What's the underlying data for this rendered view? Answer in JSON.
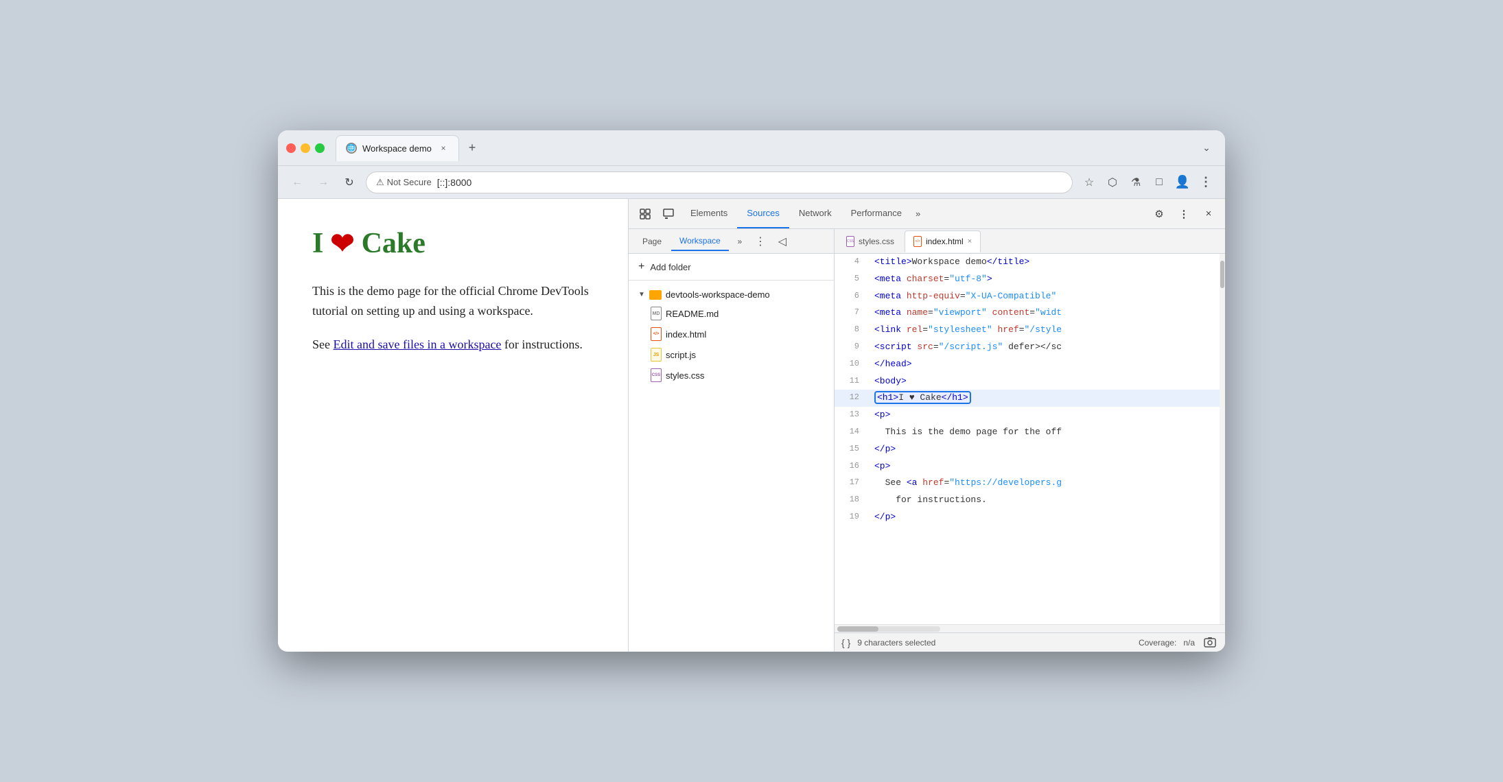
{
  "browser": {
    "tab_title": "Workspace demo",
    "tab_close": "×",
    "new_tab": "+",
    "dropdown": "⌄",
    "back_btn": "←",
    "forward_btn": "→",
    "refresh_btn": "↻",
    "not_secure": "Not Secure",
    "address": "[::]:8000",
    "bookmark_icon": "☆",
    "extensions_icon": "⬡",
    "flask_icon": "⚗",
    "devtools_toggle": "□",
    "profile_icon": "👤",
    "menu_icon": "⋮"
  },
  "devtools": {
    "toolbar": {
      "cursor_icon": "⊹",
      "inspect_icon": "⊡",
      "tabs": [
        "Elements",
        "Sources",
        "Network",
        "Performance"
      ],
      "active_tab": "Sources",
      "more_tabs": "»",
      "settings_icon": "⚙",
      "menu_icon": "⋮",
      "close_icon": "×"
    },
    "sources": {
      "tabs": [
        "Page",
        "Workspace"
      ],
      "active_tab": "Workspace",
      "more_icon": "»",
      "menu_icon": "⋮",
      "nav_toggle": "◁",
      "add_folder": "+ Add folder",
      "folder_name": "devtools-workspace-demo",
      "files": [
        {
          "name": "README.md",
          "type": "md"
        },
        {
          "name": "index.html",
          "type": "html"
        },
        {
          "name": "script.js",
          "type": "js"
        },
        {
          "name": "styles.css",
          "type": "css"
        }
      ],
      "editor_tabs": [
        {
          "name": "styles.css",
          "type": "css"
        },
        {
          "name": "index.html",
          "type": "html",
          "active": true
        }
      ]
    },
    "code": {
      "lines": [
        {
          "num": 4,
          "content": "    <title>Workspace demo</title>",
          "tokens": [
            {
              "type": "tag",
              "text": "    <title>"
            },
            {
              "type": "text",
              "text": "Workspace demo"
            },
            {
              "type": "tag",
              "text": "</title>"
            }
          ]
        },
        {
          "num": 5,
          "content": "    <meta charset=\"utf-8\">",
          "tokens": [
            {
              "type": "tag",
              "text": "    <meta "
            },
            {
              "type": "attr-name",
              "text": "charset"
            },
            {
              "type": "text",
              "text": "="
            },
            {
              "type": "attr-val",
              "text": "\"utf-8\""
            },
            {
              "type": "tag",
              "text": ">"
            }
          ]
        },
        {
          "num": 6,
          "content": "    <meta http-equiv=\"X-UA-Compatible\"",
          "tokens": [
            {
              "type": "tag",
              "text": "    <meta "
            },
            {
              "type": "attr-name",
              "text": "http-equiv"
            },
            {
              "type": "text",
              "text": "="
            },
            {
              "type": "attr-val",
              "text": "\"X-UA-Compatible\""
            }
          ]
        },
        {
          "num": 7,
          "content": "    <meta name=\"viewport\" content=\"widt",
          "tokens": [
            {
              "type": "tag",
              "text": "    <meta "
            },
            {
              "type": "attr-name",
              "text": "name"
            },
            {
              "type": "text",
              "text": "="
            },
            {
              "type": "attr-val",
              "text": "\"viewport\""
            },
            {
              "type": "text",
              "text": " "
            },
            {
              "type": "attr-name",
              "text": "content"
            },
            {
              "type": "text",
              "text": "="
            },
            {
              "type": "attr-val",
              "text": "\"widt"
            }
          ]
        },
        {
          "num": 8,
          "content": "    <link rel=\"stylesheet\" href=\"/style",
          "tokens": [
            {
              "type": "tag",
              "text": "    <link "
            },
            {
              "type": "attr-name",
              "text": "rel"
            },
            {
              "type": "text",
              "text": "="
            },
            {
              "type": "attr-val",
              "text": "\"stylesheet\""
            },
            {
              "type": "text",
              "text": " "
            },
            {
              "type": "attr-name",
              "text": "href"
            },
            {
              "type": "text",
              "text": "="
            },
            {
              "type": "attr-val",
              "text": "\"style"
            }
          ]
        },
        {
          "num": 9,
          "content": "    <script src=\"/script.js\" defer></sc",
          "tokens": [
            {
              "type": "tag",
              "text": "    <script "
            },
            {
              "type": "attr-name",
              "text": "src"
            },
            {
              "type": "text",
              "text": "="
            },
            {
              "type": "attr-val",
              "text": "\"/script.js\""
            },
            {
              "type": "text",
              "text": " defer></sc"
            }
          ]
        },
        {
          "num": 10,
          "content": "  </head>",
          "tokens": [
            {
              "type": "tag",
              "text": "  </head>"
            }
          ]
        },
        {
          "num": 11,
          "content": "  <body>",
          "tokens": [
            {
              "type": "tag",
              "text": "  <body>"
            }
          ]
        },
        {
          "num": 12,
          "content": "    <h1>I ♥ Cake</h1>",
          "highlighted": true,
          "tokens": [
            {
              "type": "tag",
              "text": "    "
            },
            {
              "type": "selected",
              "text": "<h1>I ♥ Cake</h1>"
            }
          ]
        },
        {
          "num": 13,
          "content": "    <p>",
          "tokens": [
            {
              "type": "tag",
              "text": "    <p>"
            }
          ]
        },
        {
          "num": 14,
          "content": "      This is the demo page for the off",
          "tokens": [
            {
              "type": "text",
              "text": "      This is the demo page for the off"
            }
          ]
        },
        {
          "num": 15,
          "content": "    </p>",
          "tokens": [
            {
              "type": "tag",
              "text": "    </p>"
            }
          ]
        },
        {
          "num": 16,
          "content": "    <p>",
          "tokens": [
            {
              "type": "tag",
              "text": "    <p>"
            }
          ]
        },
        {
          "num": 17,
          "content": "      See <a href=\"https://developers.g",
          "tokens": [
            {
              "type": "text",
              "text": "      See "
            },
            {
              "type": "tag",
              "text": "<a "
            },
            {
              "type": "attr-name",
              "text": "href"
            },
            {
              "type": "text",
              "text": "="
            },
            {
              "type": "attr-val",
              "text": "\"https://developers.g"
            }
          ]
        },
        {
          "num": 18,
          "content": "        for instructions.",
          "tokens": [
            {
              "type": "text",
              "text": "        for instructions."
            }
          ]
        },
        {
          "num": 19,
          "content": "    </p>",
          "tokens": [
            {
              "type": "tag",
              "text": "    </p>"
            }
          ]
        }
      ]
    },
    "status_bar": {
      "braces": "{ }",
      "selected": "9 characters selected",
      "coverage_label": "Coverage:",
      "coverage_value": "n/a",
      "screenshot_icon": "⊡"
    }
  },
  "page": {
    "heading_part1": "I",
    "heading_heart": "❤",
    "heading_part2": "Cake",
    "para1": "This is the demo page for the official Chrome DevTools tutorial on setting up and using a workspace.",
    "para2_prefix": "See ",
    "para2_link": "Edit and save files in a workspace",
    "para2_suffix": " for instructions."
  }
}
